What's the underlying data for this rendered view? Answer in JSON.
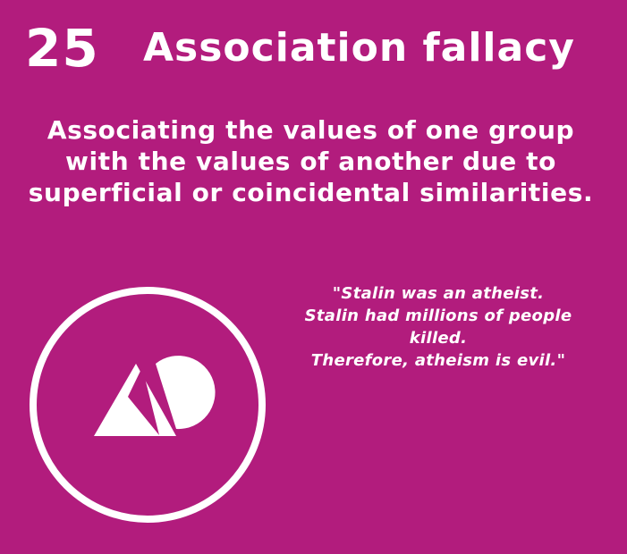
{
  "card": {
    "number": "25",
    "title": "Association fallacy",
    "definition": "Associating the values of one group with the values of another due to superficial or coincidental similarities.",
    "example": {
      "lines": [
        "\"Stalin was an atheist.",
        "Stalin had millions of people",
        "killed.",
        "Therefore, atheism is evil.\""
      ]
    },
    "icon": "triangle-circle-overlap-icon",
    "colors": {
      "background": "#b21c7d",
      "foreground": "#ffffff"
    }
  }
}
